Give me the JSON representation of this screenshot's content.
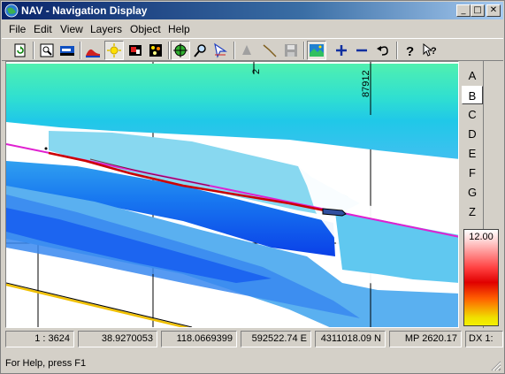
{
  "window": {
    "title": "NAV - Navigation Display"
  },
  "titlebar": {
    "minimize": "_",
    "maximize": "□",
    "close": "✕"
  },
  "menu": [
    "File",
    "Edit",
    "View",
    "Layers",
    "Object",
    "Help"
  ],
  "toolbar": {
    "tools": [
      "refresh-icon",
      "zoom-window-icon",
      "vessel-icon",
      "profile-icon",
      "sun-icon",
      "flag-icon",
      "palette-icon",
      "target-icon",
      "magnify-icon",
      "pointer-icon",
      "ship-icon",
      "track-icon",
      "save-icon",
      "layer-image-icon",
      "plus-icon",
      "minus-icon",
      "undo-icon",
      "help-icon",
      "context-help-icon"
    ]
  },
  "map": {
    "grid_labels": [
      "2",
      "87912"
    ],
    "colors": {
      "track": "#cc0000",
      "route": "#e020d0",
      "boundary": "#f0c000",
      "grid": "#000000"
    }
  },
  "layer_tabs": [
    "A",
    "B",
    "C",
    "D",
    "E",
    "F",
    "G",
    "Z"
  ],
  "selected_layer": "B",
  "legend": {
    "max_label": "12.00"
  },
  "coordinates": {
    "scale": "1 : 3624",
    "lat": "38.9270053",
    "lon": "118.0669399",
    "easting": "592522.74 E",
    "northing": "4311018.09 N",
    "mp": "MP 2620.17",
    "dx": "DX 1:"
  },
  "status": {
    "text": "For Help, press F1"
  }
}
